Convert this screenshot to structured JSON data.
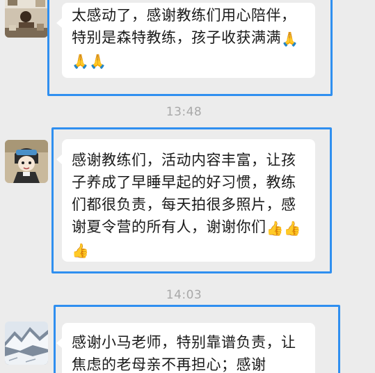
{
  "messages": [
    {
      "text": "太感动了，感谢教练们用心陪伴，特别是森特教练，孩子收获满满",
      "emojis": [
        "🙏",
        "🙏",
        "🙏"
      ],
      "emoji_icon": "folded-hands-icon",
      "avatar_icon": "cafe-scene-avatar"
    },
    {
      "text": "感谢教练们，活动内容丰富，让孩子养成了早睡早起的好习惯，教练们都很负责，每天拍很多照片，感谢夏令营的所有人，谢谢你们",
      "emojis": [
        "👍",
        "👍",
        "👍"
      ],
      "emoji_icon": "thumbs-up-icon",
      "avatar_icon": "cartoon-girl-avatar"
    },
    {
      "text": "感谢小马老师，特别靠谱负责，让焦虑的老母亲不再担心；感谢",
      "emojis": [],
      "avatar_icon": "snowy-mountain-avatar"
    }
  ],
  "timestamps": [
    "13:48",
    "14:03"
  ],
  "colors": {
    "background": "#ececec",
    "bubble": "#ffffff",
    "highlight": "#2f8ff0",
    "timestamp": "#a8a8a8",
    "text": "#1a1a1a"
  }
}
